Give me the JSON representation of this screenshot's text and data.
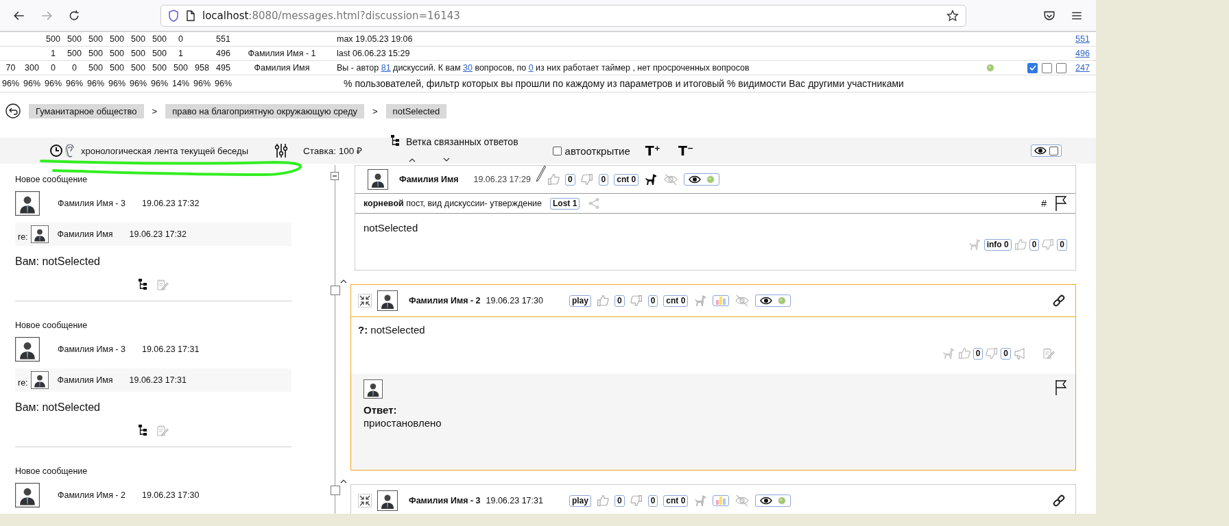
{
  "browser": {
    "url_host": "localhost",
    "url_path": ":8080/messages.html?discussion=16143"
  },
  "stats": {
    "rows": [
      {
        "kind": "numbers",
        "cells": [
          null,
          null,
          "500",
          "500",
          "500",
          "500",
          "500",
          "500",
          "0",
          null,
          "551"
        ],
        "info": [
          {
            "kind": "text",
            "text": "max 19.05.23 19:06"
          }
        ],
        "link": "551"
      },
      {
        "kind": "numbers",
        "cells": [
          null,
          null,
          "1",
          "500",
          "500",
          "500",
          "500",
          "500",
          "1",
          null,
          "496"
        ],
        "name": "Фамилия Имя - 1",
        "info": [
          {
            "kind": "text",
            "text": "last 06.06.23 15:29"
          }
        ],
        "link": "496"
      },
      {
        "kind": "numbers",
        "cells": [
          "70",
          "300",
          "0",
          "0",
          "500",
          "500",
          "500",
          "500",
          "500",
          "958",
          "495"
        ],
        "name": "Фамилия Имя",
        "info": [
          {
            "kind": "text",
            "text": "Вы - автор "
          },
          {
            "kind": "link",
            "text": "81"
          },
          {
            "kind": "text",
            "text": " дискуссий. К вам "
          },
          {
            "kind": "link",
            "text": "30"
          },
          {
            "kind": "text",
            "text": " вопросов, по "
          },
          {
            "kind": "link",
            "text": "0"
          },
          {
            "kind": "text",
            "text": " из них работает таймер , нет просроченных вопросов"
          }
        ],
        "status": true,
        "checks": [
          {
            "checked": true
          },
          {
            "checked": false
          },
          {
            "checked": false
          }
        ],
        "link": "247"
      },
      {
        "kind": "percent",
        "cells": [
          "96%",
          "96%",
          "96%",
          "96%",
          "96%",
          "96%",
          "96%",
          "96%",
          "14%",
          "96%",
          "96%"
        ],
        "caption": "% пользователей, фильтр которых вы прошли по каждому из параметров и итоговый % видимости Вас другими участниками"
      }
    ]
  },
  "breadcrumb": [
    {
      "kind": "chip",
      "label": "Гуманитарное общество"
    },
    {
      "kind": "separator",
      "label": ">"
    },
    {
      "kind": "chip",
      "label": "право на благоприятную окружающую среду"
    },
    {
      "kind": "separator",
      "label": ">"
    },
    {
      "kind": "chip",
      "label": "notSelected"
    }
  ],
  "toolbar": {
    "feed_label": "хронологическая лента текущей беседы",
    "stake": "Ставка: 100 ₽",
    "branch_label": "Ветка связанных ответов",
    "autoopen": {
      "label": "автооткрытие",
      "checked": false
    },
    "font_up": "T$^{+}$",
    "font_down": "T$^{−}$",
    "visibility": {
      "checked": false
    }
  },
  "feed": [
    {
      "title": "Новое сообщение",
      "author": "Фамилия Имя - 3",
      "time": "19.06.23 17:32",
      "reply": {
        "prefix": "re:",
        "author": "Фамилия Имя",
        "time": "19.06.23 17:32"
      },
      "body": "Вам: notSelected"
    },
    {
      "title": "Новое сообщение",
      "author": "Фамилия Имя - 3",
      "time": "19.06.23 17:31",
      "reply": {
        "prefix": "re:",
        "author": "Фамилия Имя",
        "time": "19.06.23 17:31"
      },
      "body": "Вам: notSelected"
    },
    {
      "title": "Новое сообщение",
      "author": "Фамилия Имя - 2",
      "time": "19.06.23 17:30"
    }
  ],
  "posts": [
    {
      "kind": "root",
      "expanded": true,
      "highlighted": false,
      "author": "Фамилия Имя",
      "time": "19.06.23 17:29",
      "likes": "0",
      "dislikes": "0",
      "cnt": "cnt 0",
      "subheader": "**корневой** пост, вид дискуссии- утверждение",
      "lost": "Lost 1",
      "hash": "#",
      "body": "notSelected",
      "info": "info 0",
      "footer_likes": "0",
      "footer_dislikes": "0"
    },
    {
      "kind": "reply",
      "highlighted": true,
      "author": "Фамилия Имя - 2",
      "time": "19.06.23 17:30",
      "play": "play",
      "likes": "0",
      "dislikes": "0",
      "cnt": "cnt 0",
      "body": "**?:** notSelected",
      "footer_likes": "0",
      "footer_dislikes": "0",
      "answer": {
        "label": "Ответ:",
        "text": "приостановлено"
      }
    },
    {
      "kind": "reply",
      "highlighted": false,
      "author": "Фамилия Имя - 3",
      "time": "19.06.23 17:31",
      "play": "play",
      "likes": "0",
      "dislikes": "0",
      "cnt": "cnt 0"
    }
  ]
}
